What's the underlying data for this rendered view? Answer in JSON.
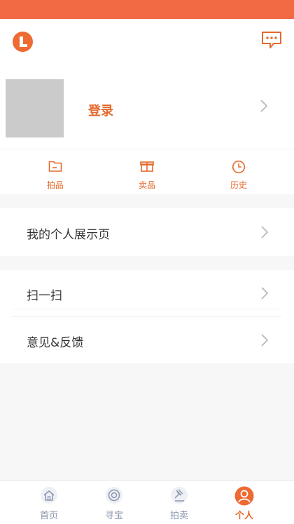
{
  "colors": {
    "accent": "#e36a2d",
    "status_bar": "#f26a43",
    "tab_inactive": "#8a96ad",
    "background": "#f7f7f7"
  },
  "header": {
    "logo_icon": "app-logo-icon",
    "message_icon": "chat-bubble-icon"
  },
  "profile": {
    "login_label": "登录",
    "chevron_icon": "chevron-right-icon"
  },
  "quick_actions": [
    {
      "label": "拍品",
      "icon": "folder-icon"
    },
    {
      "label": "卖品",
      "icon": "gift-box-icon"
    },
    {
      "label": "历史",
      "icon": "clock-icon"
    }
  ],
  "menu": {
    "showcase": "我的个人展示页",
    "scan": "扫一扫",
    "feedback": "意见&反馈"
  },
  "tabbar": [
    {
      "label": "首页",
      "icon": "home-icon",
      "active": false
    },
    {
      "label": "寻宝",
      "icon": "target-icon",
      "active": false
    },
    {
      "label": "拍卖",
      "icon": "gavel-icon",
      "active": false
    },
    {
      "label": "个人",
      "icon": "user-icon",
      "active": true
    }
  ]
}
